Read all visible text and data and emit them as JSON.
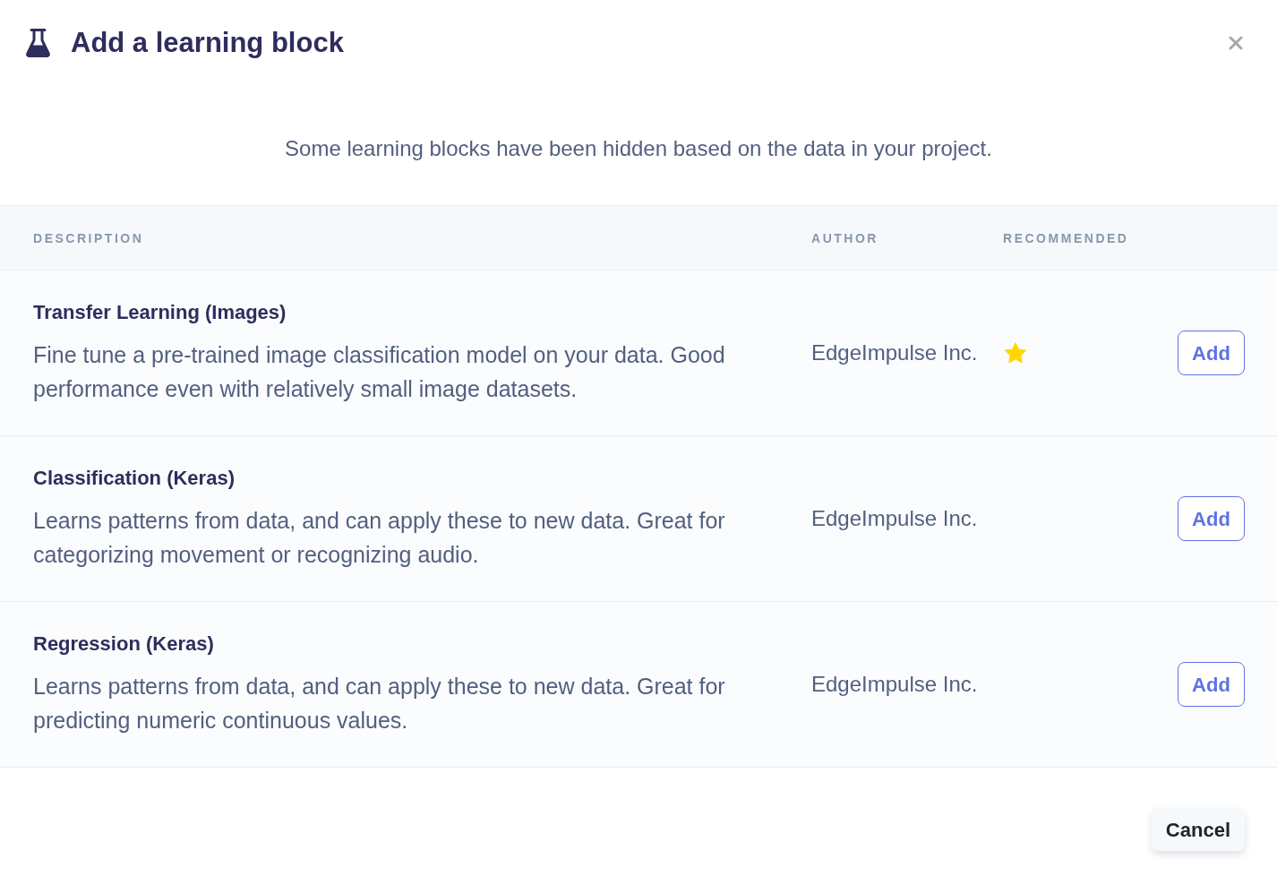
{
  "dialog": {
    "title": "Add a learning block",
    "notice": "Some learning blocks have been hidden based on the data in your project.",
    "table": {
      "columns": [
        "DESCRIPTION",
        "AUTHOR",
        "RECOMMENDED"
      ],
      "rows": [
        {
          "name": "Transfer Learning (Images)",
          "description": "Fine tune a pre-trained image classification model on your data. Good performance even with relatively small image datasets.",
          "author": "EdgeImpulse Inc.",
          "recommended": true,
          "action": "Add"
        },
        {
          "name": "Classification (Keras)",
          "description": "Learns patterns from data, and can apply these to new data. Great for categorizing movement or recognizing audio.",
          "author": "EdgeImpulse Inc.",
          "recommended": false,
          "action": "Add"
        },
        {
          "name": "Regression (Keras)",
          "description": "Learns patterns from data, and can apply these to new data. Great for predicting numeric continuous values.",
          "author": "EdgeImpulse Inc.",
          "recommended": false,
          "action": "Add"
        }
      ]
    },
    "buttons": [
      "Cancel"
    ]
  }
}
